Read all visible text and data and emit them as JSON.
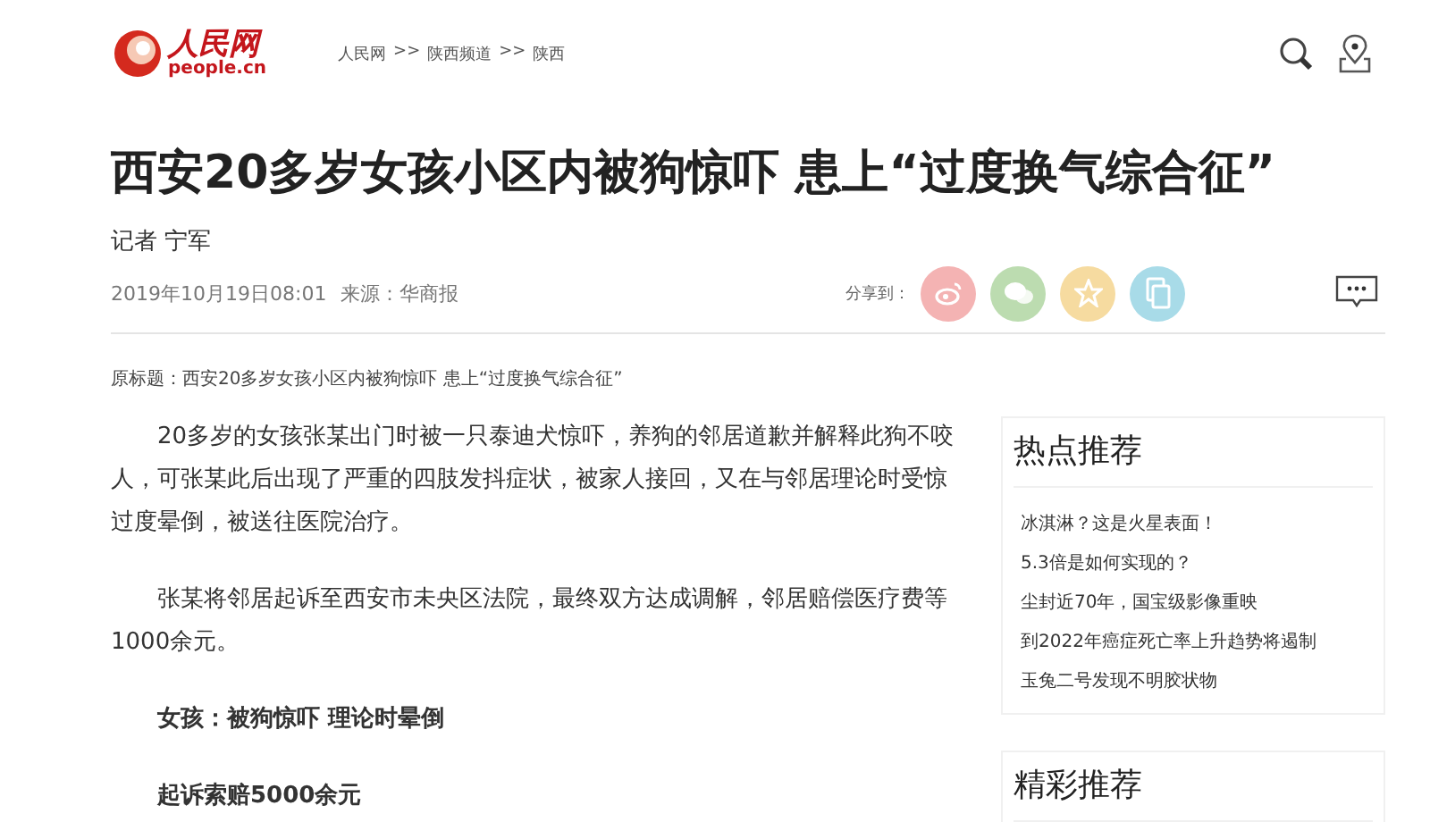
{
  "header": {
    "logo_text": "人民网",
    "logo_domain": "people.cn",
    "breadcrumb": [
      "人民网",
      ">>",
      "陕西频道",
      ">>",
      "陕西"
    ]
  },
  "article": {
    "title": "西安20多岁女孩小区内被狗惊吓 患上“过度换气综合征”",
    "author": "记者 宁军",
    "date": "2019年10月19日08:01",
    "source": "来源：华商报",
    "share_label": "分享到：",
    "share_buttons": [
      {
        "kind": "weibo",
        "color": "#f4b3b3"
      },
      {
        "kind": "wechat",
        "color": "#bcdcb0"
      },
      {
        "kind": "favorite",
        "color": "#f6dba0"
      },
      {
        "kind": "copy",
        "color": "#a8dbe8"
      }
    ],
    "original_title": "原标题：西安20多岁女孩小区内被狗惊吓 患上“过度换气综合征”",
    "paragraphs": [
      {
        "kind": "text",
        "text": "20多岁的女孩张某出门时被一只泰迪犬惊吓，养狗的邻居道歉并解释此狗不咬人，可张某此后出现了严重的四肢发抖症状，被家人接回，又在与邻居理论时受惊过度晕倒，被送往医院治疗。"
      },
      {
        "kind": "text",
        "text": "张某将邻居起诉至西安市未央区法院，最终双方达成调解，邻居赔偿医疗费等1000余元。"
      },
      {
        "kind": "subheading",
        "text": "女孩：被狗惊吓 理论时晕倒"
      },
      {
        "kind": "subheading",
        "text": "起诉索赔5000余元"
      }
    ]
  },
  "sidebar": [
    {
      "heading": "热点推荐",
      "items": [
        "冰淇淋？这是火星表面！",
        "5.3倍是如何实现的？",
        "尘封近70年，国宝级影像重映",
        "到2022年癌症死亡率上升趋势将遏制",
        "玉兔二号发现不明胶状物"
      ]
    },
    {
      "heading": "精彩推荐"
    }
  ]
}
